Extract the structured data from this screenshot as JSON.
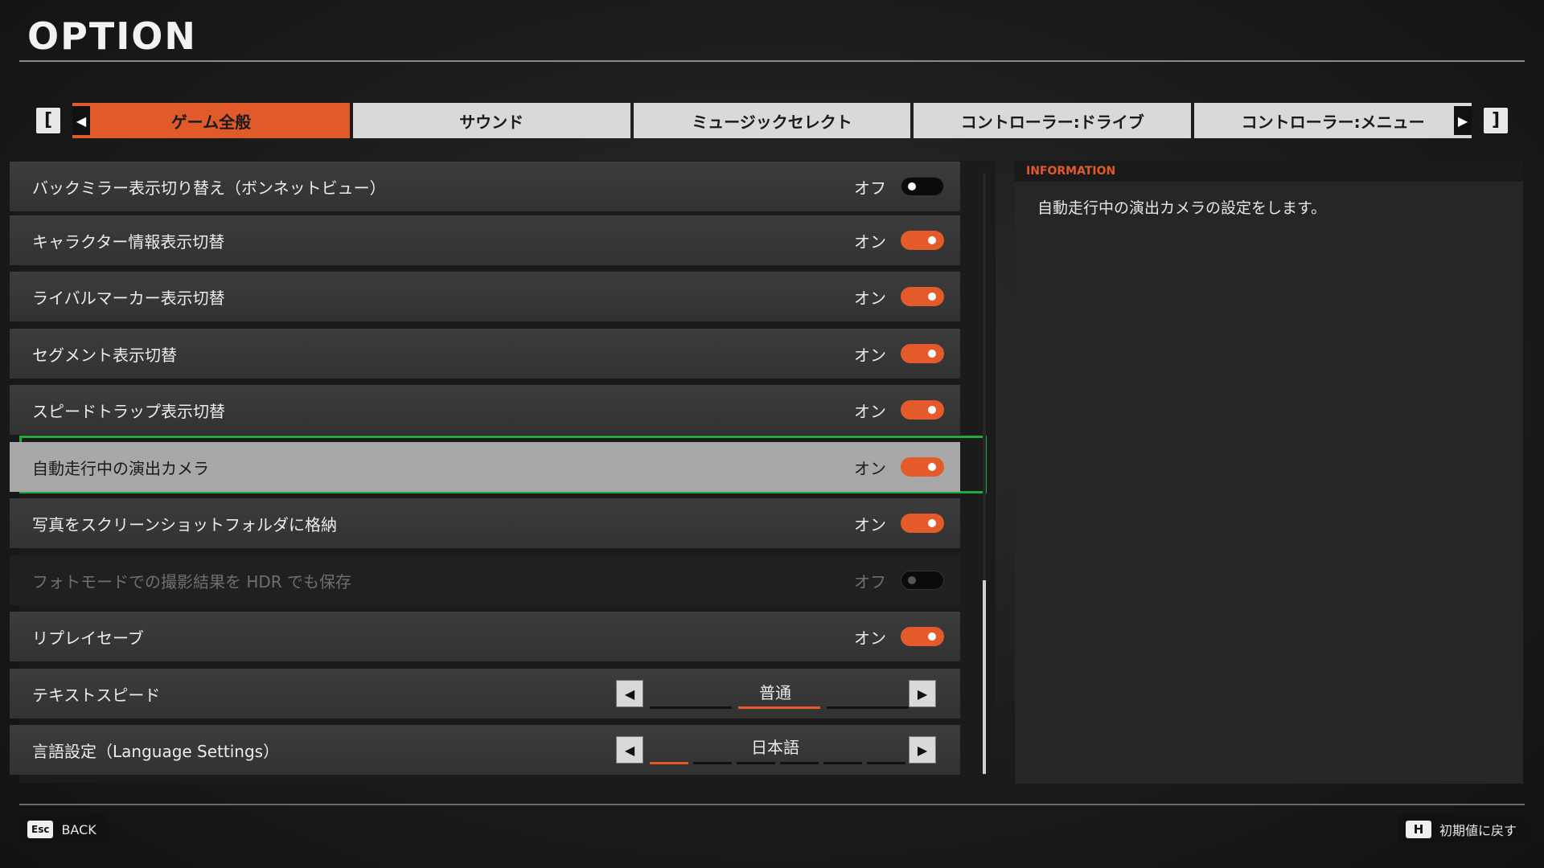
{
  "header": {
    "title": "OPTION"
  },
  "tabs": {
    "left_bracket": "[",
    "right_bracket": "]",
    "items": [
      {
        "label": "ゲーム全般",
        "active": true
      },
      {
        "label": "サウンド",
        "active": false
      },
      {
        "label": "ミュージックセレクト",
        "active": false
      },
      {
        "label": "コントローラー:ドライブ",
        "active": false
      },
      {
        "label": "コントローラー:メニュー",
        "active": false
      }
    ]
  },
  "settings": {
    "rows": [
      {
        "label": "バックミラー表示切り替え（ボンネットビュー）",
        "value": "オフ",
        "state": "off"
      },
      {
        "label": "キャラクター情報表示切替",
        "value": "オン",
        "state": "on"
      },
      {
        "label": "ライバルマーカー表示切替",
        "value": "オン",
        "state": "on"
      },
      {
        "label": "セグメント表示切替",
        "value": "オン",
        "state": "on"
      },
      {
        "label": "スピードトラップ表示切替",
        "value": "オン",
        "state": "on"
      },
      {
        "label": "自動走行中の演出カメラ",
        "value": "オン",
        "state": "on",
        "selected": true
      },
      {
        "label": "写真をスクリーンショットフォルダに格納",
        "value": "オン",
        "state": "on"
      },
      {
        "label": "フォトモードでの撮影結果を HDR でも保存",
        "value": "オフ",
        "state": "off",
        "disabled": true
      },
      {
        "label": "リプレイセーブ",
        "value": "オン",
        "state": "on"
      }
    ],
    "text_speed": {
      "label": "テキストスピード",
      "value": "普通"
    },
    "language": {
      "label": "言語設定（Language Settings）",
      "value": "日本語"
    }
  },
  "info": {
    "heading": "INFORMATION",
    "text": "自動走行中の演出カメラの設定をします。"
  },
  "footer": {
    "back_key": "Esc",
    "back_label": "BACK",
    "reset_key": "H",
    "reset_label": "初期値に戻す"
  },
  "colors": {
    "accent": "#e05a2a",
    "selection_border": "#1faa3f"
  }
}
